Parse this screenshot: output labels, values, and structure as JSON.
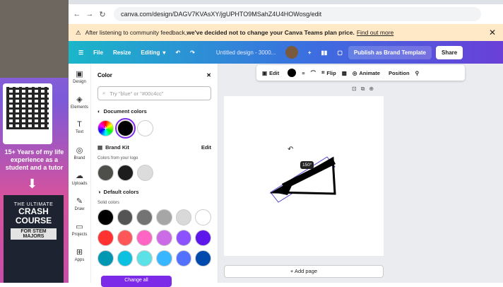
{
  "browser": {
    "url": "canva.com/design/DAGV7KVAsXY/jgUPHTO9MSahZ4U4HOWosg/edit"
  },
  "notice": {
    "text_prefix": "After listening to community feedback, ",
    "text_bold": "we've decided not to change your Canva Teams plan price.",
    "link": "Find out more"
  },
  "toolbar": {
    "file": "File",
    "resize": "Resize",
    "editing": "Editing",
    "title": "Untitled design - 3000...",
    "publish": "Publish as Brand Template",
    "share": "Share"
  },
  "rail": {
    "items": [
      "Design",
      "Elements",
      "Text",
      "Brand",
      "Uploads",
      "Draw",
      "Projects",
      "Apps"
    ]
  },
  "panel": {
    "title": "Color",
    "search_placeholder": "Try \"blue\" or \"#00c4cc\"",
    "document_colors": "Document colors",
    "brand_kit": "Brand Kit",
    "brand_edit": "Edit",
    "from_logo": "Colors from your logo",
    "default_colors": "Default colors",
    "solid_colors": "Solid colors",
    "change_all": "Change all"
  },
  "context": {
    "edit": "Edit",
    "flip": "Flip",
    "animate": "Animate",
    "position": "Position"
  },
  "canvas": {
    "rotation": "150°",
    "add_page": "+ Add page"
  },
  "left": {
    "promo": "15+ Years of my life experience as a student and a tutor",
    "book_top": "THE ULTIMATE",
    "book_title": "CRASH COURSE",
    "book_sub": "FOR STEM MAJORS"
  },
  "colors": {
    "doc": [
      "#000000",
      "#ffffff"
    ],
    "logo": [
      "#4e4e4b",
      "#1d1d1d",
      "#dcdcdc"
    ],
    "row1": [
      "#000000",
      "#545454",
      "#737373",
      "#a6a6a6",
      "#d9d9d9",
      "#ffffff"
    ],
    "row2": [
      "#ff3131",
      "#ff5757",
      "#ff66c4",
      "#cb6ce6",
      "#8c52ff",
      "#5e17eb"
    ],
    "row3": [
      "#0097b2",
      "#0cc0df",
      "#5ce1e6",
      "#38b6ff",
      "#5271ff",
      "#004aad"
    ]
  }
}
